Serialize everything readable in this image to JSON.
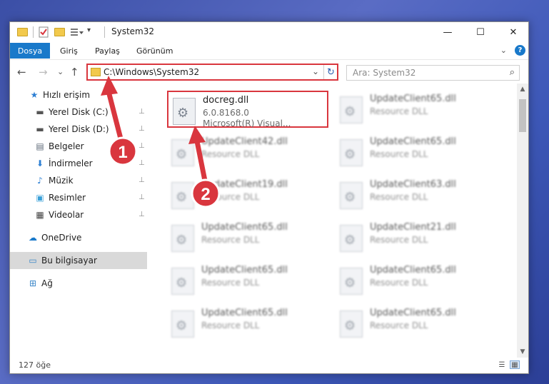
{
  "window": {
    "title": "System32",
    "controls": {
      "minimize": "—",
      "maximize": "☐",
      "close": "✕"
    }
  },
  "ribbon": {
    "tabs": [
      "Dosya",
      "Giriş",
      "Paylaş",
      "Görünüm"
    ]
  },
  "nav": {
    "back": "←",
    "forward": "→",
    "recent": "⌄",
    "up": "↑",
    "address": "C:\\Windows\\System32",
    "address_chevron": "⌄",
    "refresh": "↻",
    "search_placeholder": "Ara: System32"
  },
  "sidebar": {
    "items": [
      {
        "label": "Hızlı erişim",
        "icon": "star-icon",
        "glyph": "★",
        "color": "#2d7fd3"
      },
      {
        "label": "Yerel Disk (C:)",
        "icon": "drive-c-icon",
        "glyph": "▬",
        "color": "#555555",
        "pin": true
      },
      {
        "label": "Yerel Disk (D:)",
        "icon": "drive-d-icon",
        "glyph": "▬",
        "color": "#555555",
        "pin": true
      },
      {
        "label": "Belgeler",
        "icon": "documents-icon",
        "glyph": "▤",
        "color": "#5f6b7a",
        "pin": true
      },
      {
        "label": "İndirmeler",
        "icon": "downloads-icon",
        "glyph": "⬇",
        "color": "#2d7fd3",
        "pin": true
      },
      {
        "label": "Müzik",
        "icon": "music-icon",
        "glyph": "♪",
        "color": "#2d7fd3",
        "pin": true
      },
      {
        "label": "Resimler",
        "icon": "pictures-icon",
        "glyph": "▣",
        "color": "#3aa0d8",
        "pin": true
      },
      {
        "label": "Videolar",
        "icon": "videos-icon",
        "glyph": "▦",
        "color": "#444444",
        "pin": true
      },
      {
        "label": "OneDrive",
        "icon": "onedrive-icon",
        "glyph": "☁",
        "color": "#1979ca"
      },
      {
        "label": "Bu bilgisayar",
        "icon": "computer-icon",
        "glyph": "▭",
        "color": "#3a86c8",
        "selected": true
      },
      {
        "label": "Ağ",
        "icon": "network-icon",
        "glyph": "⊞",
        "color": "#3a86c8"
      }
    ],
    "pin_glyph": "📌"
  },
  "files": [
    {
      "name": "docreg.dll",
      "line1": "6.0.8168.0",
      "line2": "Microsoft(R) Visual...",
      "highlight": true
    },
    {
      "name": "UpdateClient65.dll",
      "line1": "Resource DLL",
      "line2": ""
    },
    {
      "name": "UpdateClient42.dll",
      "line1": "Resource DLL",
      "line2": ""
    },
    {
      "name": "UpdateClient65.dll",
      "line1": "Resource DLL",
      "line2": ""
    },
    {
      "name": "UpdateClient19.dll",
      "line1": "Resource DLL",
      "line2": ""
    },
    {
      "name": "UpdateClient63.dll",
      "line1": "Resource DLL",
      "line2": ""
    },
    {
      "name": "UpdateClient65.dll",
      "line1": "Resource DLL",
      "line2": ""
    },
    {
      "name": "UpdateClient21.dll",
      "line1": "Resource DLL",
      "line2": ""
    },
    {
      "name": "UpdateClient65.dll",
      "line1": "Resource DLL",
      "line2": ""
    },
    {
      "name": "UpdateClient65.dll",
      "line1": "Resource DLL",
      "line2": ""
    },
    {
      "name": "UpdateClient65.dll",
      "line1": "Resource DLL",
      "line2": ""
    },
    {
      "name": "UpdateClient65.dll",
      "line1": "Resource DLL",
      "line2": ""
    }
  ],
  "status": {
    "count": "127 öğe"
  },
  "annotations": {
    "label1": "1",
    "label2": "2",
    "color": "#d9363e"
  }
}
